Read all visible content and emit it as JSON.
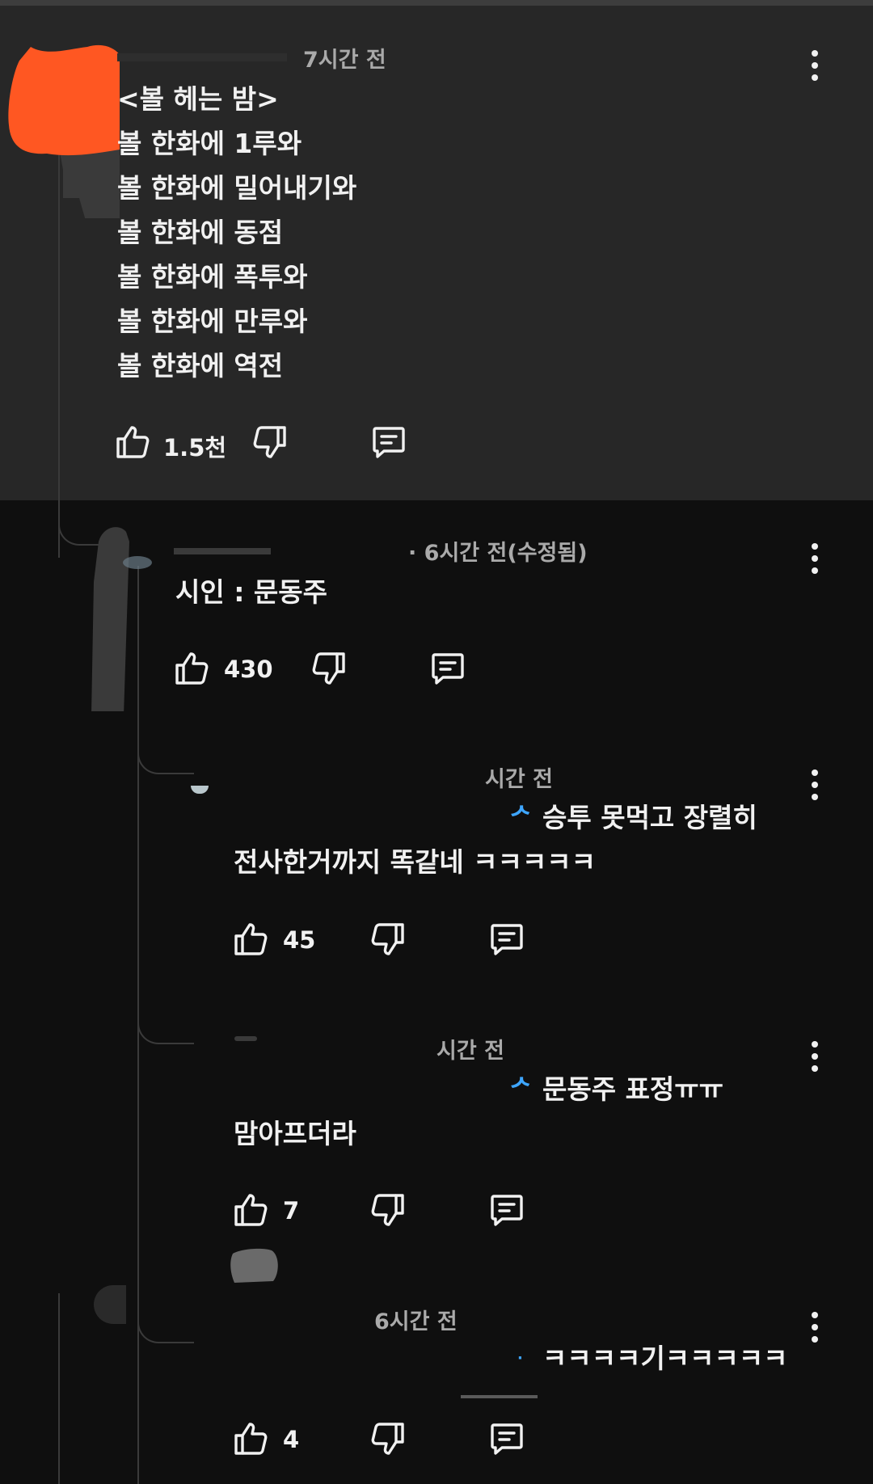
{
  "icons": {
    "like": "thumb-up-icon",
    "dislike": "thumb-down-icon",
    "reply": "reply-comment-icon",
    "more": "vertical-dots-icon"
  },
  "colors": {
    "background": "#0f0f0f",
    "highlight": "#272727",
    "text": "#f1f1f1",
    "meta": "#aaaaaa",
    "mention": "#3ea6ff"
  },
  "comments": [
    {
      "time": "7시간 전",
      "lines": [
        "<볼 헤는 밤>",
        "볼 한화에 1루와",
        "볼 한화에 밀어내기와",
        "볼 한화에 동점",
        "볼 한화에 폭투와",
        "볼 한화에 만루와",
        "볼 한화에 역전"
      ],
      "likes": "1.5천"
    },
    {
      "time": "· 6시간 전(수정됨)",
      "lines": [
        "시인 : 문동주"
      ],
      "likes": "430"
    },
    {
      "time": "시간 전",
      "mention_mark": "ᄼ",
      "lines": [
        "승투 못먹고 장렬히",
        "전사한거까지 똑같네 ㅋㅋㅋㅋㅋ"
      ],
      "likes": "45"
    },
    {
      "time": "시간 전",
      "mention_mark": "ᄼ",
      "lines": [
        "문동주 표정ㅠㅠ",
        "맘아프더라"
      ],
      "likes": "7"
    },
    {
      "time": "6시간 전",
      "mention_mark": "ᄼ",
      "lines": [
        "ㅋㅋㅋㅋ기ㅋㅋㅋㅋㅋ"
      ],
      "likes": "4"
    }
  ]
}
